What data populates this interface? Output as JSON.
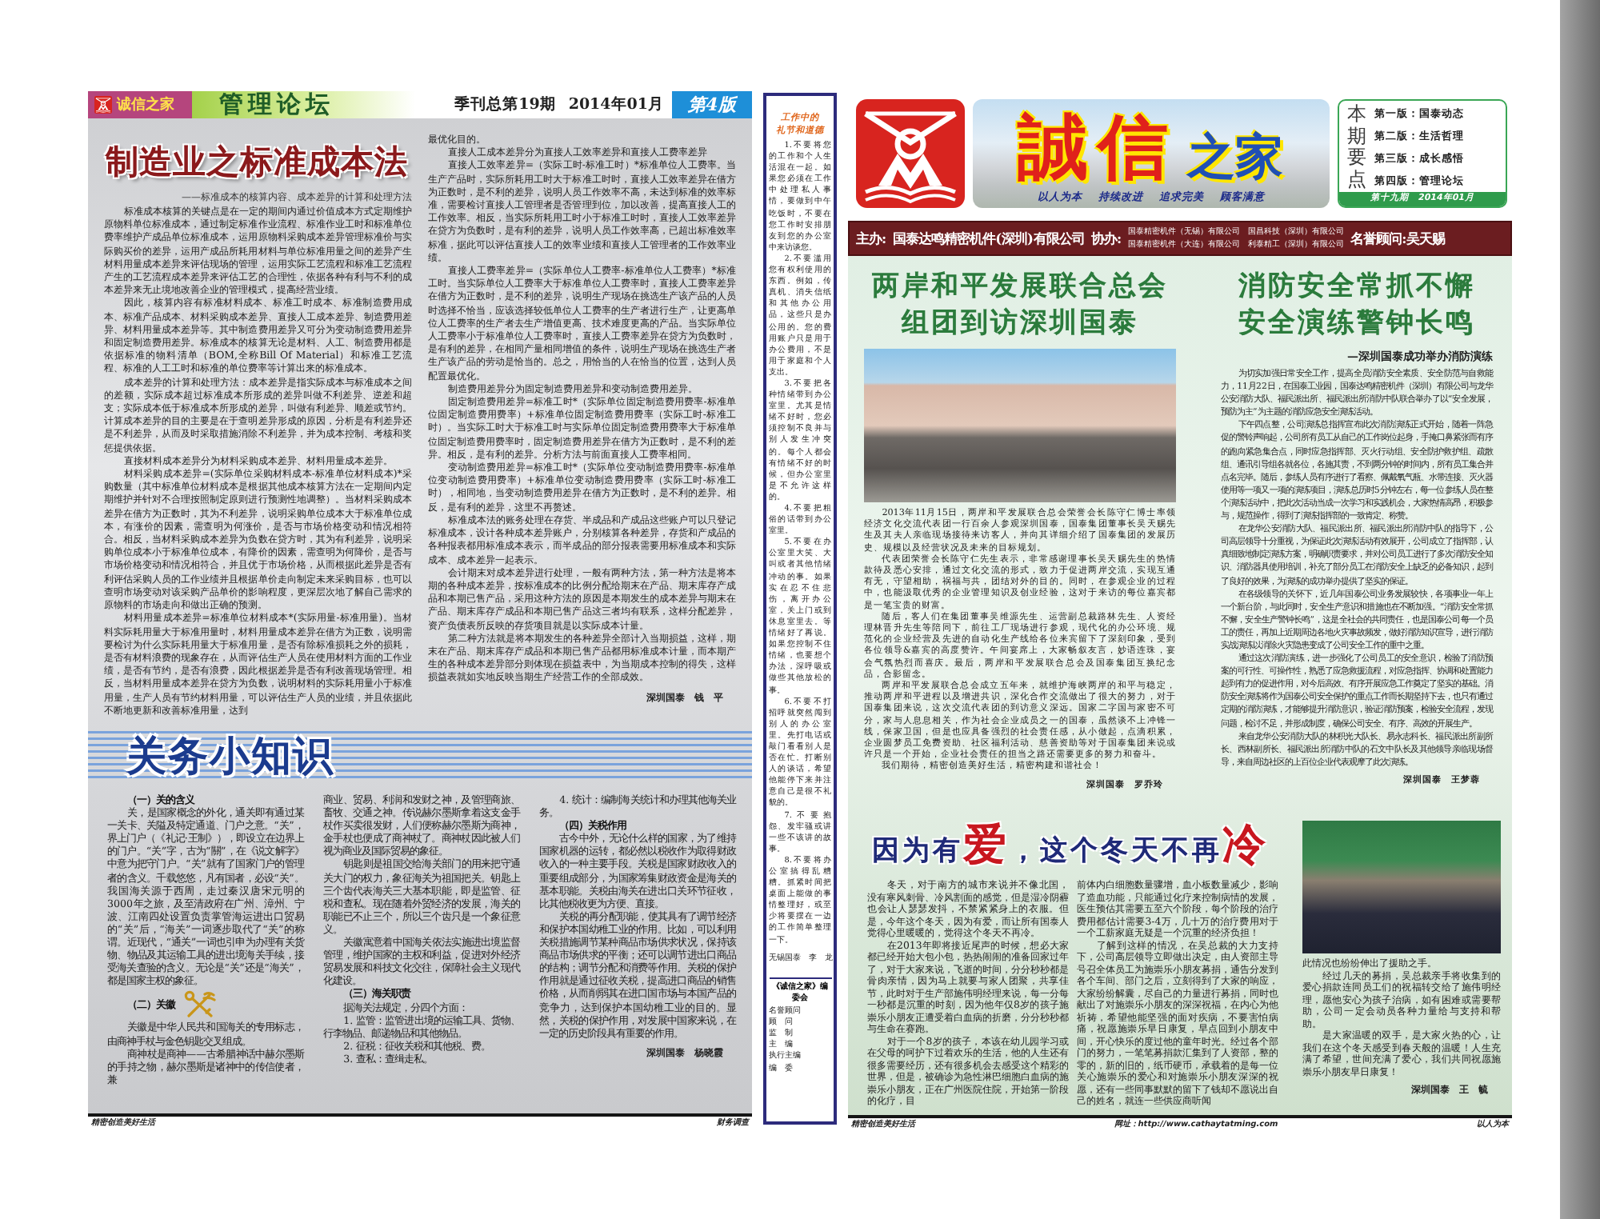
{
  "left_page": {
    "header": {
      "logo_text": "诚信之家",
      "section": "管理论坛",
      "issue": "季刊总第19期",
      "date": "2014年01月",
      "page_label": "第4版"
    },
    "article": {
      "title": "制造业之标准成本法",
      "subtitle": "——标准成本的核算内容、成本差异的计算和处理方法",
      "columns": [
        [
          {
            "kind": "para",
            "text": "标准成本核算的关键点是在一定的期间内通过价值成本方式定期维护原物料单位标准成本，通过制定标准作业流程、标准作业工时和标准单位费率维护产成品单位标准成本，运用原物料采购成本差异管理标准价与实际购买价的差异，运用产成品所耗用材料与单位标准用量之间的差异产生材料用量成本差异来评估现场的管理，运用实际工艺流程和标准工艺流程产生的工艺流程成本差异来评估工艺的合理性，依据各种有利与不利的成本差异来无止境地改善企业的管理模式，提高经营业绩。"
          },
          {
            "kind": "para",
            "text": "因此，核算内容有标准材料成本、标准工时成本、标准制造费用成本、标准产品成本、材料采购成本差异、直接人工成本差异、制造费用差异、材料用量成本差异等。其中制造费用差异又可分为变动制造费用差异和固定制造费用差异。标准成本的核算无论是材料、人工、制造费用都是依据标准的物料清单（BOM,全称Bill Of Material）和标准工艺流程、标准的人工工时和标准的单位费率等计算出来的标准成本。"
          },
          {
            "kind": "para",
            "text": "成本差异的计算和处理方法：成本差异是指实际成本与标准成本之间的差额，实际成本超过标准成本所形成的差异叫做不利差异、逆差和超支；实际成本低于标准成本所形成的差异，叫做有利差异、顺差或节约。计算成本差异的目的主要是在于查明差异形成的原因，分析是有利差异还是不利差异，从而及时采取措施消除不利差异，并为成本控制、考核和奖惩提供依据。"
          },
          {
            "kind": "para",
            "text": "直接材料成本差异分为材料采购成本差异、材料用量成本差异。"
          },
          {
            "kind": "para",
            "text": "材料采购成本差异=(实际单位采购材料成本-标准单位材料成本)*采购数量（其中标准单位材料成本是根据其他成本核算方法在一定期间内定期维护并针对不合理按照制定原则进行预测性地调整）。当材料采购成本差异在借方为正数时，其为不利差异，说明采购单位成本大于标准单位成本，有涨价的因素，需查明为何涨价，是否与市场价格变动和情况相符合。相反，当材料采购成本差异为负数在贷方时，其为有利差异，说明采购单位成本小于标准单位成本，有降价的因素，需查明为何降价，是否与市场价格变动和情况相符合，并且优于市场价格，从而根据此差异是否有利评估采购人员的工作业绩并且根据单价走向制定未来采购目标，也可以查明市场变动对该采购产品单价的影响程度，更深层次地了解自己需求的原物料的市场走向和做出正确的预测。"
          },
          {
            "kind": "para",
            "text": "材料用量成本差异=标准单位材料成本*(实际用量-标准用量)。当材料实际耗用量大于标准用量时，材料用量成本差异在借方为正数，说明需要检讨为什么实际耗用量大于标准用量，是否有除标准损耗之外的损耗，是否有材料浪费的现象存在，从而评估生产人员在使用材料方面的工作业绩，是否有节约，是否有浪费，因此根据差异是否有利改善现场管理。相反，当材料用量成本差异在贷方为负数，说明材料的实际耗用量小于标准用量，生产人员有节约材料用量，可以评估生产人员的业绩，并且依据此不断地更新和改善标准用量，达到"
          }
        ],
        [
          {
            "kind": "cont",
            "text": "最优化目的。"
          },
          {
            "kind": "para",
            "text": "直接人工成本差异分为直接人工效率差异和直接人工费率差异"
          },
          {
            "kind": "para",
            "text": "直接人工效率差异=（实际工时-标准工时）*标准单位人工费率。当生产产品时，实际所耗用工时大于标准工时时，直接人工效率差异在借方为正数时，是不利的差异，说明人员工作效率不高，未达到标准的效率标准，需要检讨直接人工管理者是否管理到位，加以改善，提高直接人工的工作效率。相反，当实际所耗用工时小于标准工时时，直接人工效率差异在贷方为负数时，是有利的差异，说明人员工作效率高，已超出标准效率标准，据此可以评估直接人工的效率业绩和直接人工管理者的工作效率业绩。"
          },
          {
            "kind": "para",
            "text": "直接人工费率差异=（实际单位人工费率-标准单位人工费率）*标准工时。当实际单位人工费率大于标准单位人工费率时，直接人工费率差异在借方为正数时，是不利的差异，说明生产现场在挑选生产该产品的人员时选择不恰当，应该选择较低单位人工费率的生产者进行生产，让更高单位人工费率的生产者去生产增值更高、技术难度更高的产品。当实际单位人工费率小于标准单位人工费率时，直接人工费率差异在贷方为负数时，是有利的差异，在相同产量相同增值的条件，说明生产现场在挑选生产者生产该产品的劳动是恰当的。总之，用恰当的人在恰当的位置，达到人员配置最优化。"
          },
          {
            "kind": "para",
            "text": "制造费用差异分为固定制造费用差异和变动制造费用差异。"
          },
          {
            "kind": "para",
            "text": "固定制造费用差异=标准工时*（实际单位固定制造费用费率-标准单位固定制造费用费率）+标准单位固定制造费用费率（实际工时-标准工时）。当实际工时大于标准工时与实际单位固定制造费用费率大于标准单位固定制造费用费率时，固定制造费用差异在借方为正数时，是不利的差异。相反，是有利的差异。分析方法与前面直接人工费率相同。"
          },
          {
            "kind": "para",
            "text": "变动制造费用差异=标准工时*（实际单位变动制造费用费率-标准单位变动制造费用费率）+标准单位变动制造费用费率（实际工时-标准工时），相同地，当变动制造费用差异在借方为正数时，是不利的差异。相反，是有利的差异，这里不再赘述。"
          },
          {
            "kind": "para",
            "text": "标准成本法的账务处理在存货、半成品和产成品这些账户可以只登记标准成本，设计各种成本差异账户，分别核算各种差异，存货和产成品的各种报表都用标准成本表示，而半成品的部分报表需要用标准成本和实际成本、成本差异一起表示。"
          },
          {
            "kind": "para",
            "text": "会计期末对成本差异进行处理，一般有两种方法，第一种方法是将本期的各种成本差异，按标准成本的比例分配给期末在产品、期末库存产成品和本期已售产品，采用这种方法的原因是本期发生的成本差异与期末在产品、期末库存产成品和本期已售产品这三者均有联系，这样分配差异，资产负债表所反映的存货项目就是以实际成本计量。"
          },
          {
            "kind": "para",
            "text": "第二种方法就是将本期发生的各种差异全部计入当期损益，这样，期末在产品、期末库存产成品和本期已售产品都用标准成本计量，而本期产生的各种成本差异部分则体现在损益表中，为当期成本控制的得失，这样损益表就如实地反映当期生产经营工作的全部成效。"
          }
        ]
      ],
      "byline": "深圳国泰　钱　平"
    },
    "customs": {
      "heading": "关务小知识",
      "columns": [
        [
          {
            "kind": "heading",
            "text": "（一）关的含义"
          },
          {
            "kind": "para",
            "text": "关，是国家概念的外化，通关即有通过某一关卡、关隘及特定通道、门户之意。“关”，界上门户（《礼记·王制》），即设立在边界上的门户。“关”字，古为“關”，在《说文解字》中意为把守门户。“关”就有了国家门户的管理者的含义。千载悠悠，凡有国者，必设“关”。我国海关源于西周，走过秦汉唐宋元明的3000年之旅，及至清政府在广州、漳州、宁波、江南四处设置负责掌管海运进出口贸易的“关”后，“海关”一词逐步取代了“关”的称谓。近现代，“通关”一词也引申为办理有关货物、物品及其运输工具的进出境海关手续，接受海关查验的含义。无论是“关”还是“海关”，都是国家主权的象征。"
          },
          {
            "kind": "emblem_heading",
            "text": "（二）关徽"
          },
          {
            "kind": "para",
            "text": "关徽是中华人民共和国海关的专用标志，由商神手杖与金色钥匙交叉组成。"
          },
          {
            "kind": "para",
            "text": "商神杖是商神——古希腊神话中赫尔墨斯的手持之物，赫尔墨斯是诸神中的传信使者，兼"
          }
        ],
        [
          {
            "kind": "cont",
            "text": "商业、贸易、利润和发财之神，及管理商旅、畜牧、交通之神。传说赫尔墨斯拿着这支金手杖作买卖很发财，人们便称赫尔墨斯为商神，金手杖也便成了商神杖了。商神杖因此被人们视为商业及国际贸易的象征。"
          },
          {
            "kind": "para",
            "text": "钥匙则是祖国交给海关部门的用来把守通关大门的权力，象征海关为祖国把关。钥匙上三个齿代表海关三大基本职能，即是监管、征税和查私。现在随着外贸经济的发展，海关的职能已不止三个，所以三个齿只是一个象征意义。"
          },
          {
            "kind": "para",
            "text": "关徽寓意着中国海关依法实施进出境监督管理，维护国家的主权和利益，促进对外经济贸易发展和科技文化交往，保障社会主义现代化建设。"
          },
          {
            "kind": "heading",
            "text": "（三）海关职责"
          },
          {
            "kind": "para",
            "text": "据海关法规定，分四个方面："
          },
          {
            "kind": "para",
            "text": "1. 监管：监管进出境的运输工具、货物、行李物品、邮递物品和其他物品。"
          },
          {
            "kind": "para",
            "text": "2. 征税：征收关税和其他税、费。"
          },
          {
            "kind": "para",
            "text": "3. 查私：查缉走私。"
          }
        ],
        [
          {
            "kind": "para",
            "text": "4. 统计：编制海关统计和办理其他海关业务。"
          },
          {
            "kind": "heading",
            "text": "（四）关税作用"
          },
          {
            "kind": "para",
            "text": "古今中外，无论什么样的国家，为了维持国家机器的运转，都必然以税收作为取得财政收入的一种主要手段。关税是国家财政收入的重要组成部分，为国家筹集财政资金是海关的基本职能。关税由海关在进出口关环节征收，比其他税收更为方便、直接。"
          },
          {
            "kind": "para",
            "text": "关税的再分配职能，使其具有了调节经济和保护本国幼稚工业的作用。比如，可以利用关税措施调节某种商品市场供求状况，保持该商品市场供求的平衡；还可以调节进出口商品的结构；调节分配和消费等作用。关税的保护作用就是通过征收关税，提高进口商品的销售价格，从而削弱其在进口国市场与本国产品的竞争力，达到保护本国幼稚工业的目的。显然，关税的保护作用，对发展中国家来说，在一定的历史阶段具有重要的作用。"
          }
        ]
      ],
      "byline": "深圳国泰　杨晓霞"
    },
    "footer": {
      "left": "精密创造美好生活",
      "right": "财务调查"
    }
  },
  "sidebar": {
    "title_lines": [
      "工作中的",
      "礼节和道德"
    ],
    "items": [
      {
        "kind": "para",
        "text": "1.不要将您的工作和个人生活混在一起。如果您必须在工作中处理私人事情，要做到中午吃饭时，不要在您工作时安排朋友到您的办公室中来访谈您。"
      },
      {
        "kind": "para",
        "text": "2.不要滥用您有权利使用的东西。例如，传真机、消失信纸和其他办公用品，这些只是办公用的。您的费用账户只是用于办公费用，不是用于家庭和个人支出。"
      },
      {
        "kind": "para",
        "text": "3.不要把各种情绪带到办公室里。尤其是情绪不好时，您必须控制不良并与别人发生冲突的。每个人都会有情绪不好的时候，但办公室里是不允许这样的。"
      },
      {
        "kind": "para",
        "text": "4.不要把粗俗的话带到办公室里。"
      },
      {
        "kind": "para",
        "text": "5.不要在办公室里大笑、大叫或者其他情绪冲动的事。如果实在忍不住悲伤，离开办公室，关上门或到休息室里去。等情绪好了再说。如果您控制不住情绪，也要想个办法，深呼吸或做些其他放松的事。"
      },
      {
        "kind": "para",
        "text": "6.不要不打招呼就突然闯到别人的办公室里。先打电话或敲门看看别人是否在忙。打断别人的谈话，希望他能停下来并注意自己是很不礼貌的。"
      },
      {
        "kind": "para",
        "text": "7.不要抱怨、发牢骚或讲一些不该讲的故事。"
      },
      {
        "kind": "para",
        "text": "8.不要将办公室搞得乱糟糟。抓紧时间把桌面上能做的事情整理好，或至少将要摆在一边的工作简单整理一下。"
      }
    ],
    "byline": "无锡国泰　李　龙",
    "board": {
      "title": "《诚信之家》编委会",
      "roles": [
        "名誉顾问",
        "顾　问",
        "监　制",
        "主　编",
        "执行主编",
        "编　委"
      ]
    }
  },
  "right_page": {
    "masthead": {
      "title": "誠信",
      "title_suffix": "之家",
      "slogan": [
        "以人为本",
        "持续改进",
        "追求完美",
        "顾客满意"
      ],
      "highlights": {
        "label": "本期要点",
        "items": [
          "第一版：国泰动态",
          "第二版：生活哲理",
          "第三版：成长感悟",
          "第四版：管理论坛"
        ],
        "issue": "第十九期　2014年01月"
      }
    },
    "sponsors": {
      "host_label": "主办:",
      "host": "国泰达鸣精密机件(深圳)有限公司",
      "co_label": "协办:",
      "co_hosts": [
        "国泰精密机件（无锡）有限公司",
        "国昌科技（深圳）有限公司",
        "国泰精密机件（大连）有限公司",
        "利泰精工（深圳）有限公司"
      ],
      "adviser": "名誉顾问:吴天赐"
    },
    "articles": [
      {
        "kind": "photo",
        "headline_lines": [
          "两岸和平发展联合总会",
          "组团到访深圳国泰"
        ],
        "blocks": [
          {
            "kind": "para",
            "text": "2013年11月15日，两岸和平发展联合总会荣誉会长陈守仁博士率领经济文化交流代表团一行百余人参观深圳国泰，国泰集团董事长吴天赐先生及其夫人亲临现场接待来访客人，并向其详细介绍了国泰集团的发展历史、规模以及经营状况及未来的目标规划。"
          },
          {
            "kind": "para",
            "text": "代表团荣誉会长陈守仁先生表示，非常感谢理事长吴天赐先生的热情款待及悉心安排，通过文化交流的形式，致力于促进两岸交流，实现互通有无，守望相助，祸福与共，团结对外的目的。同时，在参观企业的过程中，也能汲取优秀的企业管理知识及创业经验，这对于来访的每位嘉宾都是一笔宝贵的财富。"
          },
          {
            "kind": "para",
            "text": "随后，客人们在集团董事吴维源先生、运营副总裁路林先生、人资经理林晋升先生等陪同下，前往工厂现场进行参观，现代化的办公环境、规范化的企业经营及先进的自动化生产线给各位来宾留下了深刻印象，受到各位领导&嘉宾的高度赞许。午间宴席上，大家畅叙友言，妙语连珠，宴会气氛热烈而喜庆。最后，两岸和平发展联合总会及国泰集团互换纪念品，合影留念。"
          },
          {
            "kind": "para",
            "text": "两岸和平发展联合总会成立五年来，就维护海峡两岸的和平与稳定，推动两岸和平进程以及增进共识，深化合作交流做出了很大的努力，对于国泰集团来说，这次交流代表团的到访意义深远。国家二字国与家密不可分，家与人息息相关，作为社会企业成员之一的国泰，虽然谈不上冲锋一线，保家卫国，但是也应具备强烈的社会责任感，从小做起，点滴积累，企业圆梦员工免费资助、社区福利活动、慈善资助等对于国泰集团来说或许只是一个开始，企业社会责任的担当之路还需要更多的努力和奋斗。"
          },
          {
            "kind": "para",
            "text": "我们期待，精密创造美好生活，精密构建和谐社会！"
          }
        ],
        "byline": "深圳国泰　罗乔玲"
      },
      {
        "kind": "subtitled",
        "headline_lines": [
          "消防安全常抓不懈",
          "安全演练警钟长鸣"
        ],
        "subtitle": "—深圳国泰成功举办消防演练",
        "blocks": [
          {
            "kind": "para",
            "text": "为切实加强日常安全工作，提高全员消防安全素质、安全防范与自救能力，11月22日，在国泰工业园，国泰达鸣精密机件（深圳）有限公司与龙华公安消防大队、福民派出所、福民派出所消防中队联合举办了以“安全发展，预防为主”为主题的消防应急安全演练活动。"
          },
          {
            "kind": "para",
            "text": "下午四点整，公司演练总指挥宣布此次消防演练正式开始，随着一阵急促的警铃声响起，公司所有员工从自己的工作岗位起身，手掩口鼻紧张而有序的跑向紧急集合点，同时应急指挥部、灭火行动组、安全防护救护组、疏散组、通讯引导组各就各位，各施其责，不到两分钟的时间内，所有员工集合并点名完毕。随后，参练人员有序进行了看察、佩戴氧气瓶、水带连接、灭火器使用等一项又一项的演练项目，演练总历时5分钟左右，每一位参练人员在整个演练活动中，把此次活动当成一次学习和实践机会，大家热情高昂，积极参与，规范操作，得到了演练指挥部的一致肯定、称赞。"
          },
          {
            "kind": "para",
            "text": "在龙华公安消防大队、福民派出所、福民派出所消防中队的指导下，公司高层领导十分重视，为保证此次演练活动有效展开，公司成立了指挥部，认真细致地制定演练方案，明确职责要求，并对公司员工进行了多次消防安全知识、消防器具使用培训，补充了部分员工在消防安全上缺乏的必备知识，起到了良好的效果，为演练的成功举办提供了坚实的保证。"
          },
          {
            "kind": "para",
            "text": "在各级领导的关怀下，近几年国泰公司业务发展较快，各项事业一年上一个新台阶，与此同时，安全生产意识和措施也在不断加强。“消防安全常抓不懈，安全生产警钟长鸣”，这是全社会的共同责任，也是国泰公司每一个员工的责任，再加上近期周边各地火灾事故频发，做好消防知识宣导，进行消防实战演练以消除火灾隐患变成了公司安全工作的重中之重。"
          },
          {
            "kind": "para",
            "text": "通过这次消防演练，进一步强化了公司员工的安全意识，检验了消防预案的可行性、可操作性，熟悉了应急救援流程，对应急指挥、协调和处置能力起到有力的促进作用，对今后高效、有序开展应急工作奠定了坚实的基础。消防安全演练将作为国泰公司安全保护的重点工作而长期坚持下去，也只有通过定期的消防演练，才能够提升消防意识，验证消防预案，检验安全流程，发现问题，检讨不足，并形成制度，确保公司安全、有序、高效的开展生产。"
          },
          {
            "kind": "para",
            "text": "来自龙华公安消防大队的林积光大队长、易永志科长、福民派出所副所长、西林副所长、福民派出所消防中队的石文中队长及其他领导亲临现场督导，来自周边社区的上百位企业代表观摩了此次演练。"
          }
        ],
        "byline": "深圳国泰　王梦蓉"
      },
      {
        "kind": "columns",
        "headline": "因为有**爱**，这个冬天不再**冷**",
        "columns": [
          [
            {
              "kind": "para",
              "text": "冬天，对于南方的城市来说并不像北国，没有寒风刺骨、冷风割面的感觉，但是湿冷阴霾也会让人瑟瑟发抖，不禁紧紧身上的衣服。但是，今年这个冬天，因为有爱，而让所有国泰人觉得心里暖暖的，觉得这个冬天不再冷。"
            },
            {
              "kind": "para",
              "text": "在2013年即将接近尾声的时候，想必大家都已经开始大包小包，热热闹闹的准备回家过年了，对于大家来说，飞逝的时间，分分秒秒都是骨肉亲情，因为马上就要与家人团聚，共享佳节，此时对于生产部施伟明经理来说，每一分每一秒都是沉重的时刻，因为他年仅8岁的孩子施崇乐小朋友正遭受着白血病的折磨，分分秒秒都与生命在赛跑。"
            },
            {
              "kind": "para",
              "text": "对于一个8岁的孩子，本该在幼儿园学习或在父母的呵护下过着欢乐的生活，他的人生还有很多需要经历，还有很多机会去感受这个精彩的世界，但是，被确诊为急性淋巴细胞白血病的施崇乐小朋友，正在广州医院住院，开始第一阶段的化疗，目"
            }
          ],
          [
            {
              "kind": "cont",
              "text": "前体内白细胞数量骤增，血小板数量减少，影响了造血功能，只能通过化疗来控制病情的发展，医生预估其需要五至六个阶段，每个阶段的治疗费用都估计需要3-4万，几十万的治疗费用对于一个工薪家庭无疑是一个沉重的经济负担！"
            },
            {
              "kind": "para",
              "text": "了解到这样的情况，在吴总裁的大力支持下，公司高层领导立即做出决定，由人资部主导号召全体员工为施崇乐小朋友募捐，通告分发到各个车间、部门之后，立刻得到了大家的响应，大家纷纷解囊，尽自己的力量进行募捐，同时也献出了对施崇乐小朋友的深深祝福，在内心为他祈祷，希望他能坚强的面对疾病，不要害怕病痛，祝愿施崇乐早日康复，早点回到小朋友中间，开心快乐的度过他的童年时光。经过各个部门的努力，一笔笔募捐款汇集到了人资部，整的零的，新的旧的，纸币硬币，承载着的是每一位关心施崇乐的爱心和对施崇乐小朋友深深的祝愿，还有一些同事默默的留下了钱却不愿说出自己的姓名，就连一些供应商听闻"
            }
          ],
          [
            {
              "kind": "cont",
              "text": "此情况也纷纷伸出了援助之手。"
            },
            {
              "kind": "para",
              "text": "经过几天的募捐，吴总裁亲手将收集到的爱心捐款连同员工们的祝福转交给了施伟明经理，愿他安心为孩子治病，如有困难或需要帮助，公司一定会动员各种力量给与支持和帮助。"
            },
            {
              "kind": "para",
              "text": "是大家温暖的双手，是大家火热的心，让我们在这个冬天感受到春天般的温暖！人生充满了希望，世间充满了爱心，我们共同祝愿施崇乐小朋友早日康复！"
            }
          ]
        ],
        "byline": "深圳国泰　王　毓"
      }
    ],
    "footer": {
      "left": "精密创造美好生活",
      "center": "网址：http://www.cathaytatming.com",
      "right": "以人为本"
    }
  }
}
